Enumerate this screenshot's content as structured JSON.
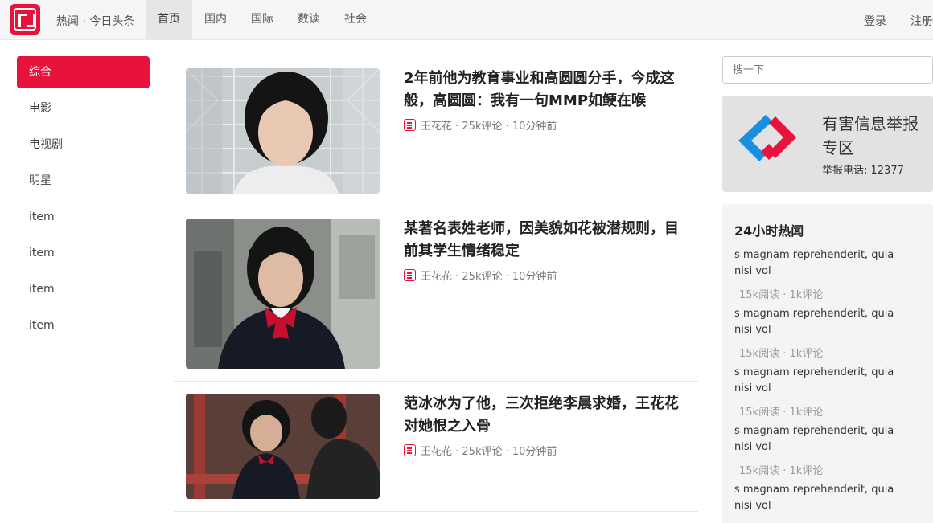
{
  "header": {
    "brand": "热闻 · 今日头条",
    "nav": [
      "首页",
      "国内",
      "国际",
      "数读",
      "社会"
    ],
    "login": "登录",
    "register": "注册"
  },
  "sidebar": {
    "items": [
      "综合",
      "电影",
      "电视剧",
      "明星",
      "item",
      "item",
      "item",
      "item"
    ]
  },
  "articles": [
    {
      "title": "2年前他为教育事业和高圆圆分手，今成这般，高圆圆：我有一句MMP如鲠在喉",
      "meta": "王花花 · 25k评论 · 10分钟前"
    },
    {
      "title": "某著名表姓老师，因美貌如花被潜规则，目前其学生情绪稳定",
      "meta": "王花花 · 25k评论 · 10分钟前"
    },
    {
      "title": "范冰冰为了他，三次拒绝李晨求婚，王花花对她恨之入骨",
      "meta": "王花花 · 25k评论 · 10分钟前"
    }
  ],
  "search": {
    "placeholder": "搜一下"
  },
  "report": {
    "title": "有害信息举报专区",
    "phone": "举报电话: 12377"
  },
  "hot": {
    "title": "24小时热闻",
    "items": [
      {
        "text": "s magnam reprehenderit, quia nisi vol",
        "meta": "15k阅读 · 1k评论"
      },
      {
        "text": "s magnam reprehenderit, quia nisi vol",
        "meta": "15k阅读 · 1k评论"
      },
      {
        "text": "s magnam reprehenderit, quia nisi vol",
        "meta": "15k阅读 · 1k评论"
      },
      {
        "text": "s magnam reprehenderit, quia nisi vol",
        "meta": "15k阅读 · 1k评论"
      },
      {
        "text": "s magnam reprehenderit, quia nisi vol",
        "meta": ""
      }
    ]
  },
  "colors": {
    "accent": "#e8123c",
    "topbar": "#f4f5f6",
    "sidebar_bg": "#f4f4f4"
  }
}
